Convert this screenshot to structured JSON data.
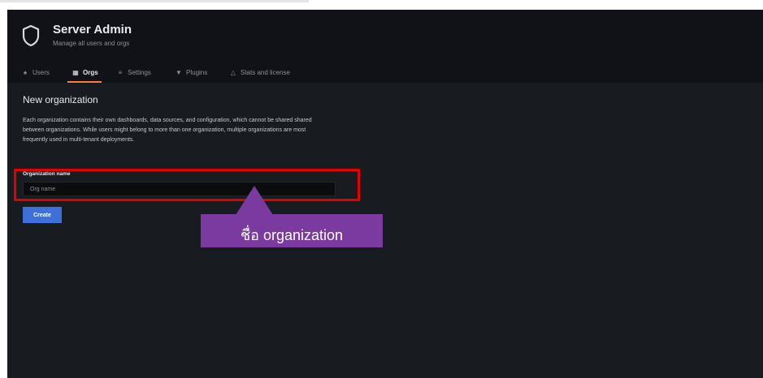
{
  "header": {
    "title": "Server Admin",
    "subtitle": "Manage all users and orgs",
    "icon": "shield-icon"
  },
  "tabs": [
    {
      "label": "Users",
      "icon": "user-icon",
      "active": false
    },
    {
      "label": "Orgs",
      "icon": "building-icon",
      "active": true
    },
    {
      "label": "Settings",
      "icon": "sliders-icon",
      "active": false
    },
    {
      "label": "Plugins",
      "icon": "plug-icon",
      "active": false
    },
    {
      "label": "Stats and license",
      "icon": "chart-icon",
      "active": false
    }
  ],
  "page": {
    "title": "New organization",
    "description": "Each organization contains their own dashboards, data sources, and configuration, which cannot be shared shared between organizations. While users might belong to more than one organization, multiple organizations are most frequently used in multi-tenant deployments."
  },
  "form": {
    "field_label": "Organization name",
    "placeholder": "Org name",
    "value": "",
    "submit_label": "Create"
  },
  "annotation": {
    "text": "ชื่อ organization",
    "highlight_color": "#e50000",
    "callout_color": "#7a3aa0"
  },
  "colors": {
    "accent": "#ff7a3d",
    "primary_button": "#3d71d9",
    "background": "#181b1f"
  }
}
